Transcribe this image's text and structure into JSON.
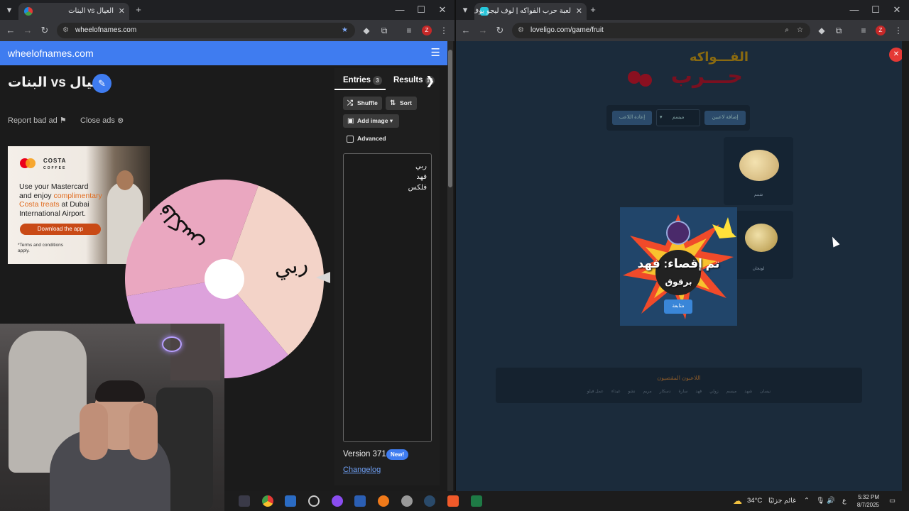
{
  "left_browser": {
    "tab_title": "البنات vs العيال",
    "url": "wheelofnames.com"
  },
  "wheel_page": {
    "brand": "wheelofnames.com",
    "title": "البنات vs العيال",
    "report_bad_ad": "Report bad ad",
    "close_ads": "Close ads",
    "ad": {
      "brand": "COSTA",
      "brand_sub": "COFFEE",
      "line1": "Use your Mastercard",
      "line2": "and enjoy",
      "highlight1": "complimentary",
      "highlight2": "Costa treats",
      "line3": "at Dubai",
      "line4": "International Airport.",
      "cta": "Download the app",
      "terms": "*Terms and conditions apply."
    },
    "wheel": {
      "slices": [
        "ربي",
        "فهد",
        "فلكس"
      ],
      "colors": [
        "#f3d3c8",
        "#dda2dc",
        "#eaa7c0"
      ]
    },
    "panel": {
      "entries_tab": "Entries",
      "entries_count": "3",
      "results_tab": "Results",
      "results_count": "10",
      "shuffle": "Shuffle",
      "sort": "Sort",
      "add_image": "Add image",
      "advanced": "Advanced",
      "entries": [
        "ربي",
        "فهد",
        "فلكس"
      ],
      "version": "Version 371",
      "new_badge": "New!",
      "changelog": "Changelog"
    }
  },
  "right_browser": {
    "tab_title": "لعبة حرب الفواكه | لوف ليجو يوف",
    "url": "loveligo.com/game/fruit"
  },
  "fruit_game": {
    "logo_top": "الفـــواكه",
    "logo_main": "حـــرب",
    "add_player": "إضافة لاعبين",
    "player_select": "ميسم",
    "restore_player": "إعادة اللاعب",
    "cards": [
      {
        "name": "شمم"
      },
      {
        "name": "لونجان"
      }
    ],
    "popup_text": "تم إقصاء: فهد",
    "popup_sub": "برقوق",
    "popup_button": "متابعة",
    "eliminated_title": "اللاعبون المقصيون",
    "eliminated": [
      "نيسان",
      "شهد",
      "ميسم",
      "زولي",
      "فهد",
      "سارة",
      "دسكار",
      "مريم",
      "نشو",
      "غيداء",
      "عمل فيلو"
    ]
  },
  "taskbar": {
    "weather": "34°C",
    "weather_label": "غائم جزئيًا",
    "lang": "ع",
    "time": "5:32 PM",
    "date": "8/7/2025"
  }
}
